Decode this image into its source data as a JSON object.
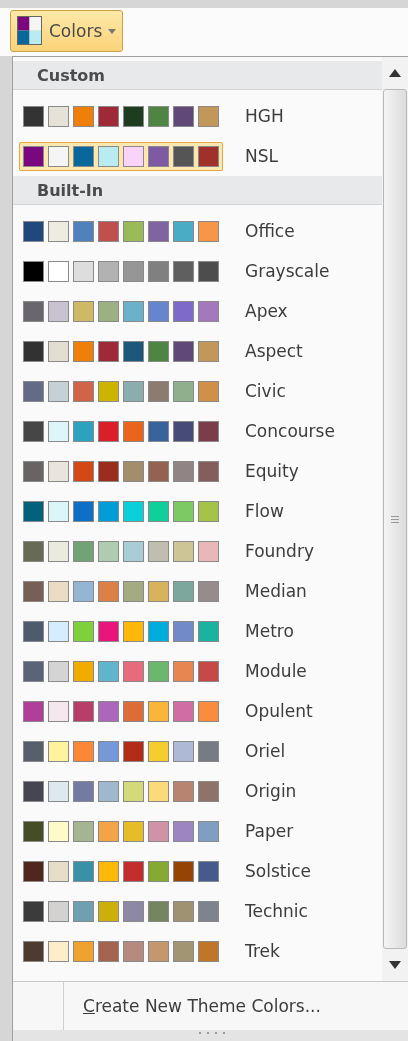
{
  "button": {
    "label": "Colors"
  },
  "sections": [
    {
      "title": "Custom",
      "themes": [
        {
          "name": "HGH",
          "selected": false,
          "swatches": [
            {
              "color": "#333333"
            },
            {
              "color": "#e6e2d8"
            },
            {
              "color": "#f07f09"
            },
            {
              "color": "#9f2936"
            },
            {
              "color": "#1e3d1e"
            },
            {
              "color": "#4e8542"
            },
            {
              "color": "#604878"
            },
            {
              "color": "#c19859"
            }
          ]
        },
        {
          "name": "NSL",
          "selected": true,
          "swatches": [
            {
              "color": "#7a0680"
            },
            {
              "color": "#f5f5f5"
            },
            {
              "color": "#0a679c"
            },
            {
              "color": "#b8ecf0"
            },
            {
              "color": "#fad4f8"
            },
            {
              "color": "#7e5aa4"
            },
            {
              "color": "#555555"
            },
            {
              "color": "#a0302a"
            }
          ]
        }
      ]
    },
    {
      "title": "Built-In",
      "themes": [
        {
          "name": "Office",
          "selected": false,
          "swatches": [
            {
              "color": "#1f497d"
            },
            {
              "color": "#eeece1"
            },
            {
              "color": "#4f81bd"
            },
            {
              "color": "#c0504d"
            },
            {
              "color": "#9bbb59"
            },
            {
              "color": "#8064a2"
            },
            {
              "color": "#4bacc6"
            },
            {
              "color": "#f79646"
            }
          ]
        },
        {
          "name": "Grayscale",
          "selected": false,
          "swatches": [
            {
              "color": "#000000"
            },
            {
              "color": "#ffffff"
            },
            {
              "color": "#dddddd"
            },
            {
              "color": "#b2b2b2"
            },
            {
              "color": "#969696"
            },
            {
              "color": "#808080"
            },
            {
              "color": "#5f5f5f"
            },
            {
              "color": "#4d4d4d"
            }
          ]
        },
        {
          "name": "Apex",
          "selected": false,
          "swatches": [
            {
              "color": "#69676d"
            },
            {
              "color": "#c9c2d1"
            },
            {
              "color": "#ceb966"
            },
            {
              "color": "#9cb084"
            },
            {
              "color": "#6bb1c9"
            },
            {
              "color": "#6585cf"
            },
            {
              "color": "#7e6bc9"
            },
            {
              "color": "#a379bb"
            }
          ]
        },
        {
          "name": "Aspect",
          "selected": false,
          "swatches": [
            {
              "color": "#323232"
            },
            {
              "color": "#e3ded1"
            },
            {
              "color": "#f07f09"
            },
            {
              "color": "#9f2936"
            },
            {
              "color": "#1b587c"
            },
            {
              "color": "#4e8542"
            },
            {
              "color": "#604878"
            },
            {
              "color": "#c19859"
            }
          ]
        },
        {
          "name": "Civic",
          "selected": false,
          "swatches": [
            {
              "color": "#646b86"
            },
            {
              "color": "#c5d1d7"
            },
            {
              "color": "#d16349"
            },
            {
              "color": "#ccb400"
            },
            {
              "color": "#8cadae"
            },
            {
              "color": "#8c7b70"
            },
            {
              "color": "#8fb08c"
            },
            {
              "color": "#d19049"
            }
          ]
        },
        {
          "name": "Concourse",
          "selected": false,
          "swatches": [
            {
              "color": "#464646"
            },
            {
              "color": "#def5fa"
            },
            {
              "color": "#2da2bf"
            },
            {
              "color": "#da1f28"
            },
            {
              "color": "#eb641b"
            },
            {
              "color": "#39639d"
            },
            {
              "color": "#474b78"
            },
            {
              "color": "#7d3c4a"
            }
          ]
        },
        {
          "name": "Equity",
          "selected": false,
          "swatches": [
            {
              "color": "#696464"
            },
            {
              "color": "#e9e5dc"
            },
            {
              "color": "#d34817"
            },
            {
              "color": "#9b2d1f"
            },
            {
              "color": "#a28e6a"
            },
            {
              "color": "#956251"
            },
            {
              "color": "#918485"
            },
            {
              "color": "#855d5d"
            }
          ]
        },
        {
          "name": "Flow",
          "selected": false,
          "swatches": [
            {
              "color": "#04617b"
            },
            {
              "color": "#dbf5f9"
            },
            {
              "color": "#0f6fc6"
            },
            {
              "color": "#009dd9"
            },
            {
              "color": "#0bd0d9"
            },
            {
              "color": "#10cf9b"
            },
            {
              "color": "#7cca62"
            },
            {
              "color": "#a5c249"
            }
          ]
        },
        {
          "name": "Foundry",
          "selected": false,
          "swatches": [
            {
              "color": "#676a55"
            },
            {
              "color": "#eaebde"
            },
            {
              "color": "#72a376"
            },
            {
              "color": "#b0ccb0"
            },
            {
              "color": "#a8cdd7"
            },
            {
              "color": "#c0beaf"
            },
            {
              "color": "#cec597"
            },
            {
              "color": "#e8b7b7"
            }
          ]
        },
        {
          "name": "Median",
          "selected": false,
          "swatches": [
            {
              "color": "#775f55"
            },
            {
              "color": "#ebddc3"
            },
            {
              "color": "#94b6d2"
            },
            {
              "color": "#dd8047"
            },
            {
              "color": "#a5ab81"
            },
            {
              "color": "#d8b25c"
            },
            {
              "color": "#7ba79d"
            },
            {
              "color": "#968c8c"
            }
          ]
        },
        {
          "name": "Metro",
          "selected": false,
          "swatches": [
            {
              "color": "#4e5b6f"
            },
            {
              "color": "#d6ecff"
            },
            {
              "color": "#7fd13b"
            },
            {
              "color": "#ea157a"
            },
            {
              "color": "#feb80a"
            },
            {
              "color": "#00addc"
            },
            {
              "color": "#738ac8"
            },
            {
              "color": "#1ab39f"
            }
          ]
        },
        {
          "name": "Module",
          "selected": false,
          "swatches": [
            {
              "color": "#5a6378"
            },
            {
              "color": "#d4d4d4"
            },
            {
              "color": "#f0ad00"
            },
            {
              "color": "#60b5cc"
            },
            {
              "color": "#e66c7d"
            },
            {
              "color": "#6bb76d"
            },
            {
              "color": "#e88651"
            },
            {
              "color": "#c64847"
            }
          ]
        },
        {
          "name": "Opulent",
          "selected": false,
          "swatches": [
            {
              "color": "#b13f9a"
            },
            {
              "color": "#f4e7ed"
            },
            {
              "color": "#b83d68"
            },
            {
              "color": "#ac66bb"
            },
            {
              "color": "#de6c36"
            },
            {
              "color": "#f9b639"
            },
            {
              "color": "#cf6da4"
            },
            {
              "color": "#fa8d3d"
            }
          ]
        },
        {
          "name": "Oriel",
          "selected": false,
          "swatches": [
            {
              "color": "#575f6d"
            },
            {
              "color": "#fff39d"
            },
            {
              "color": "#fe8637"
            },
            {
              "color": "#7598d9"
            },
            {
              "color": "#b32c16"
            },
            {
              "color": "#f5cd2d"
            },
            {
              "color": "#aebad5"
            },
            {
              "color": "#777c84"
            }
          ]
        },
        {
          "name": "Origin",
          "selected": false,
          "swatches": [
            {
              "color": "#464653"
            },
            {
              "color": "#dde9ec"
            },
            {
              "color": "#727ca3"
            },
            {
              "color": "#9fb8cd"
            },
            {
              "color": "#d2da7a"
            },
            {
              "color": "#fada7a"
            },
            {
              "color": "#b88472"
            },
            {
              "color": "#8e736a"
            }
          ]
        },
        {
          "name": "Paper",
          "selected": false,
          "swatches": [
            {
              "color": "#444d26"
            },
            {
              "color": "#fefac9"
            },
            {
              "color": "#a5b592"
            },
            {
              "color": "#f3a447"
            },
            {
              "color": "#e7bc29"
            },
            {
              "color": "#d092a7"
            },
            {
              "color": "#9c85c0"
            },
            {
              "color": "#809ec2"
            }
          ]
        },
        {
          "name": "Solstice",
          "selected": false,
          "swatches": [
            {
              "color": "#4f271c"
            },
            {
              "color": "#e7dec9"
            },
            {
              "color": "#3891a7"
            },
            {
              "color": "#feb80a"
            },
            {
              "color": "#c32d2e"
            },
            {
              "color": "#84aa33"
            },
            {
              "color": "#964305"
            },
            {
              "color": "#475a8d"
            }
          ]
        },
        {
          "name": "Technic",
          "selected": false,
          "swatches": [
            {
              "color": "#3b3b3b"
            },
            {
              "color": "#d4d2d0"
            },
            {
              "color": "#6ea0b0"
            },
            {
              "color": "#ccaf0a"
            },
            {
              "color": "#8d89a4"
            },
            {
              "color": "#748560"
            },
            {
              "color": "#9e9273"
            },
            {
              "color": "#7e848d"
            }
          ]
        },
        {
          "name": "Trek",
          "selected": false,
          "swatches": [
            {
              "color": "#4e3b30"
            },
            {
              "color": "#fbeec9"
            },
            {
              "color": "#f0a22e"
            },
            {
              "color": "#a5644e"
            },
            {
              "color": "#b58b80"
            },
            {
              "color": "#c3986d"
            },
            {
              "color": "#a19574"
            },
            {
              "color": "#c17529"
            }
          ]
        }
      ]
    }
  ],
  "footer": {
    "label": "Create New Theme Colors...",
    "access_key_shown": true
  }
}
